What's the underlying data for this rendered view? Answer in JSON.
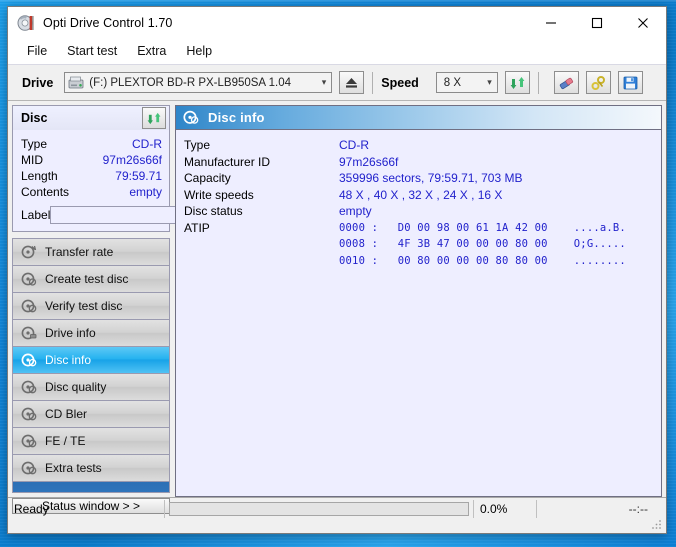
{
  "window": {
    "title": "Opti Drive Control 1.70",
    "app_icon": "disc-icon",
    "minimize": "minimize-icon",
    "maximize": "maximize-icon",
    "close": "close-icon"
  },
  "menubar": {
    "items": [
      {
        "label": "File"
      },
      {
        "label": "Start test"
      },
      {
        "label": "Extra"
      },
      {
        "label": "Help"
      }
    ]
  },
  "toolbar": {
    "drive_label": "Drive",
    "drive_value": "(F:)   PLEXTOR BD-R  PX-LB950SA 1.04",
    "eject_icon": "eject-icon",
    "speed_label": "Speed",
    "speed_value": "8 X",
    "refresh_icon": "refresh-icon",
    "erase_icon": "eraser-icon",
    "tools_icon": "wrench-icon",
    "save_icon": "floppy-save-icon"
  },
  "disc_panel": {
    "title": "Disc",
    "refresh_icon": "refresh-icon",
    "rows": [
      {
        "key": "Type",
        "value": "CD-R"
      },
      {
        "key": "MID",
        "value": "97m26s66f"
      },
      {
        "key": "Length",
        "value": "79:59.71"
      },
      {
        "key": "Contents",
        "value": "empty"
      }
    ],
    "label_key": "Label",
    "label_value": "",
    "label_placeholder": "",
    "label_button_icon": "cd-disc-icon"
  },
  "nav": {
    "items": [
      {
        "label": "Transfer rate",
        "icon": "transfer-rate-icon",
        "selected": false
      },
      {
        "label": "Create test disc",
        "icon": "create-test-disc-icon",
        "selected": false
      },
      {
        "label": "Verify test disc",
        "icon": "verify-test-disc-icon",
        "selected": false
      },
      {
        "label": "Drive info",
        "icon": "drive-info-icon",
        "selected": false
      },
      {
        "label": "Disc info",
        "icon": "disc-info-icon",
        "selected": true
      },
      {
        "label": "Disc quality",
        "icon": "disc-quality-icon",
        "selected": false
      },
      {
        "label": "CD Bler",
        "icon": "cd-bler-icon",
        "selected": false
      },
      {
        "label": "FE / TE",
        "icon": "fe-te-icon",
        "selected": false
      },
      {
        "label": "Extra tests",
        "icon": "extra-tests-icon",
        "selected": false
      }
    ],
    "status_window_button": "Status window > >"
  },
  "main": {
    "header_title": "Disc info",
    "header_icon": "disc-info-icon",
    "rows": [
      {
        "key": "Type",
        "value": "CD-R"
      },
      {
        "key": "Manufacturer ID",
        "value": "97m26s66f"
      },
      {
        "key": "Capacity",
        "value": "359996 sectors, 79:59.71, 703 MB"
      },
      {
        "key": "Write speeds",
        "value": "48 X , 40 X , 32 X , 24 X , 16 X"
      },
      {
        "key": "Disc status",
        "value": "empty"
      }
    ],
    "atip_key": "ATIP",
    "atip_lines": [
      "0000 :   D0 00 98 00 61 1A 42 00    ....a.B.",
      "0008 :   4F 3B 47 00 00 00 80 00    O;G.....",
      "0010 :   00 80 00 00 00 80 80 00    ........"
    ]
  },
  "statusbar": {
    "status": "Ready",
    "progress_percent": "0.0%",
    "progress_value": 0,
    "time": "--:--"
  },
  "colors": {
    "accent_blue": "#1287dd",
    "value_text": "#2222cc",
    "selection": "#26b3f0",
    "panel_bg": "#eeeeff"
  }
}
